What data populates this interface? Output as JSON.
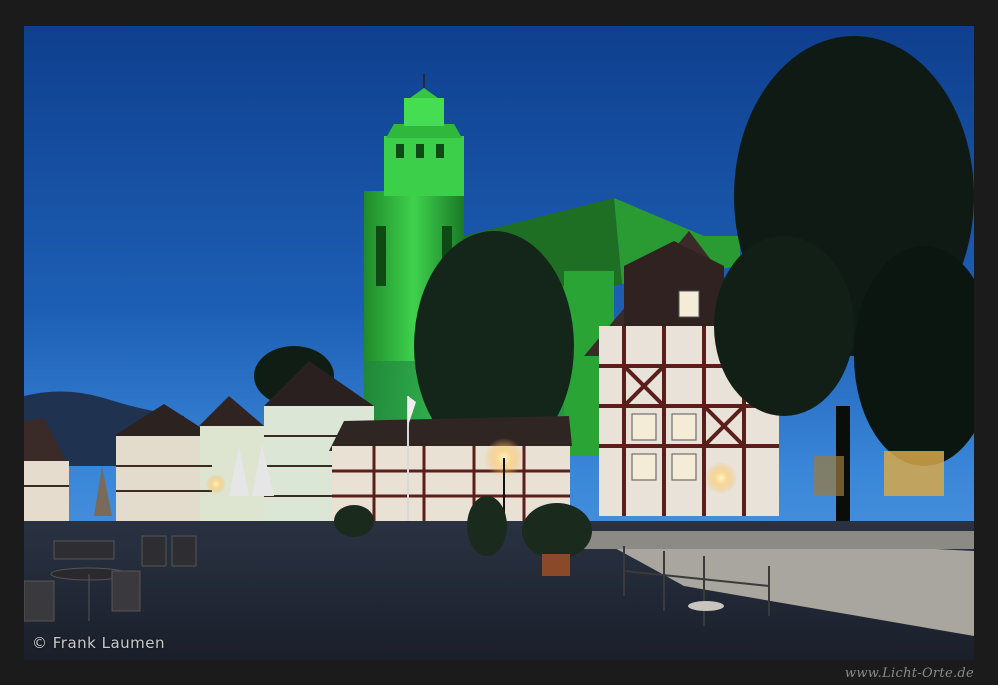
{
  "photo": {
    "scene": "night-town-square-green-lit-church",
    "sky_color": "#1d5fb5",
    "church_glow_color": "#39d94a"
  },
  "watermark": {
    "copyright": "© Frank Laumen",
    "website": "www.Licht-Orte.de"
  }
}
